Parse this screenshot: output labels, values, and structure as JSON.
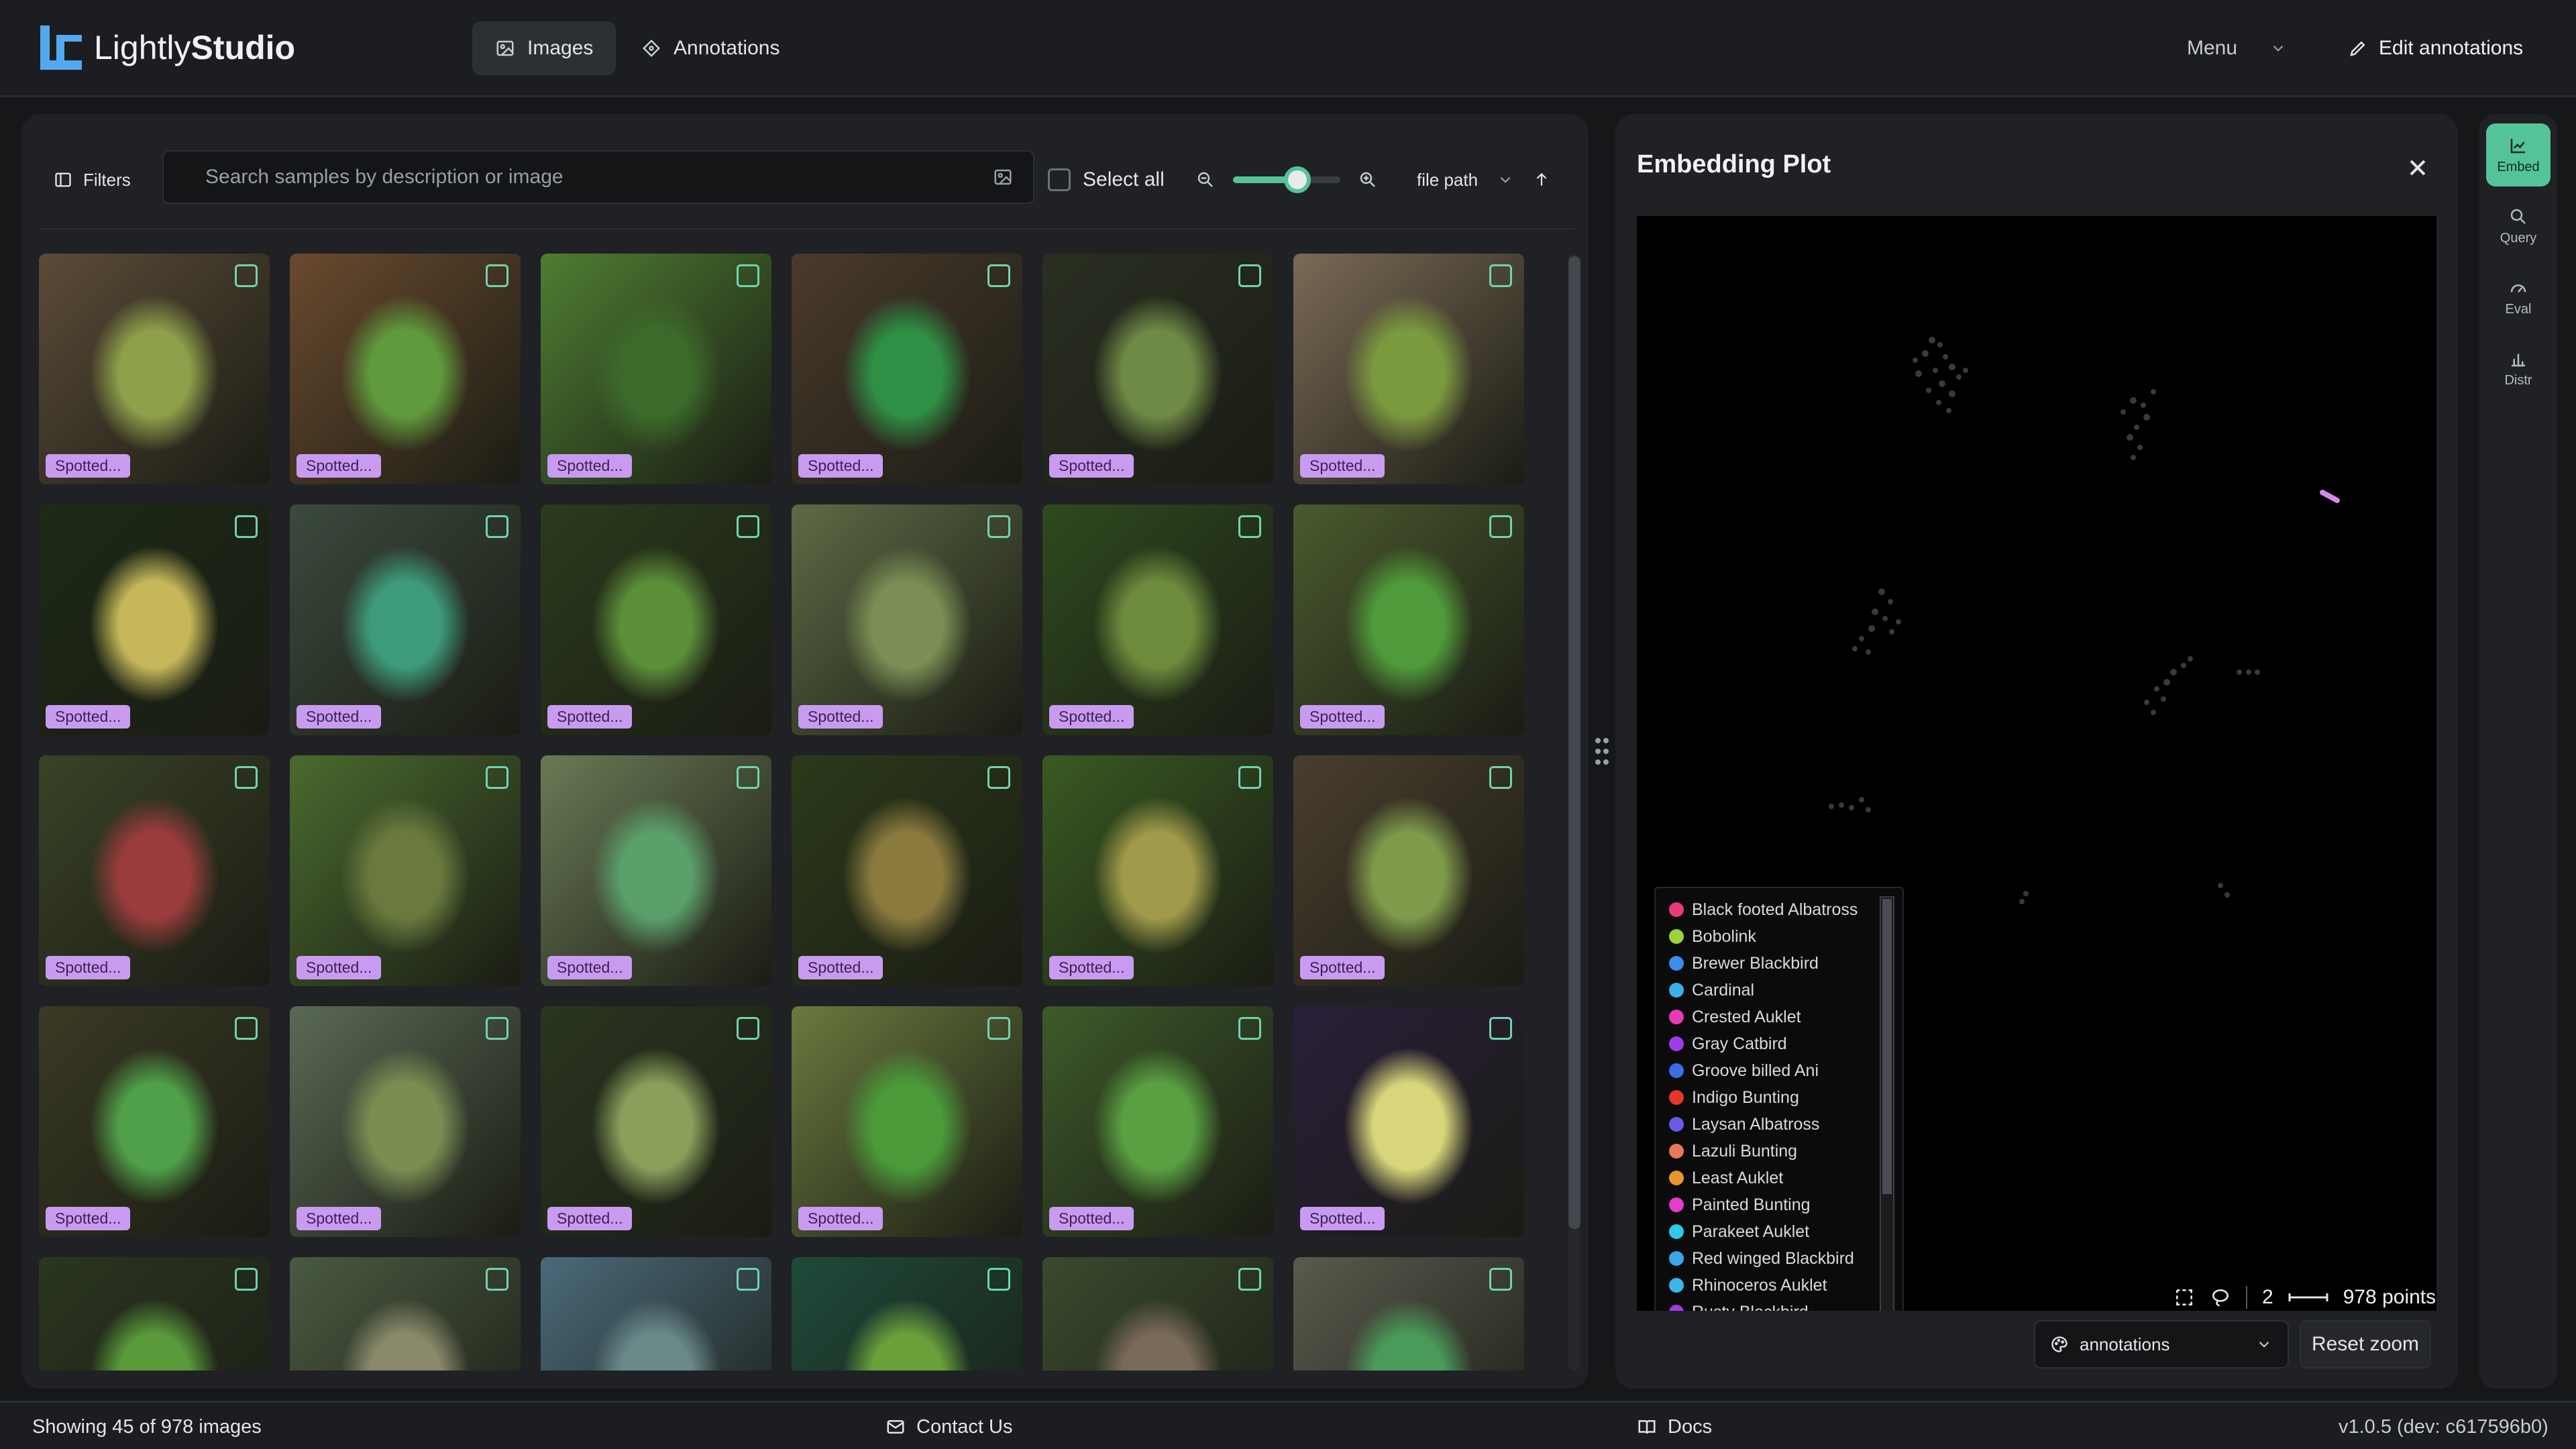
{
  "app": {
    "brand_light": "Lightly",
    "brand_bold": "Studio"
  },
  "nav": {
    "images_label": "Images",
    "annotations_label": "Annotations",
    "menu_label": "Menu",
    "edit_label": "Edit annotations"
  },
  "toolbar": {
    "filters_label": "Filters",
    "search_placeholder": "Search samples by description or image",
    "select_all_label": "Select all",
    "zoom_level": 0.6,
    "sort_field": "file path",
    "sort_direction": "ascending"
  },
  "grid": {
    "rows": [
      [
        {
          "label": "Spotted...",
          "bg": "#5b4b38",
          "fg": "#8ea04a"
        },
        {
          "label": "Spotted...",
          "bg": "#6a4a2e",
          "fg": "#5f9a3c"
        },
        {
          "label": "Spotted...",
          "bg": "#4e7d32",
          "fg": "#3c6a2a"
        },
        {
          "label": "Spotted...",
          "bg": "#4a3a2c",
          "fg": "#2e8f45"
        },
        {
          "label": "Spotted...",
          "bg": "#2a2f22",
          "fg": "#6f8a45"
        },
        {
          "label": "Spotted...",
          "bg": "#7a6a55",
          "fg": "#7b9a3e"
        }
      ],
      [
        {
          "label": "Spotted...",
          "bg": "#1d2a16",
          "fg": "#c6b85a"
        },
        {
          "label": "Spotted...",
          "bg": "#3c4a3e",
          "fg": "#3d9a7a"
        },
        {
          "label": "Spotted...",
          "bg": "#2b3b1c",
          "fg": "#5d8e3a"
        },
        {
          "label": "Spotted...",
          "bg": "#5e6a45",
          "fg": "#7a8e55"
        },
        {
          "label": "Spotted...",
          "bg": "#2f4a1e",
          "fg": "#6e8a3c"
        },
        {
          "label": "Spotted...",
          "bg": "#4a5a2e",
          "fg": "#4f9a3a"
        }
      ],
      [
        {
          "label": "Spotted...",
          "bg": "#3a4226",
          "fg": "#9a3c3c"
        },
        {
          "label": "Spotted...",
          "bg": "#4a6a2e",
          "fg": "#6a7a3e"
        },
        {
          "label": "Spotted...",
          "bg": "#6a7a55",
          "fg": "#5aa06a"
        },
        {
          "label": "Spotted...",
          "bg": "#2c3a1a",
          "fg": "#8a7a3e"
        },
        {
          "label": "Spotted...",
          "bg": "#3a5a22",
          "fg": "#a09a4a"
        },
        {
          "label": "Spotted...",
          "bg": "#4a3e2e",
          "fg": "#7e9a4a"
        }
      ],
      [
        {
          "label": "Spotted...",
          "bg": "#3a3a24",
          "fg": "#4fa048"
        },
        {
          "label": "Spotted...",
          "bg": "#5a6a55",
          "fg": "#7a8e52"
        },
        {
          "label": "Spotted...",
          "bg": "#2a3620",
          "fg": "#8aa05a"
        },
        {
          "label": "Spotted...",
          "bg": "#6a7a3e",
          "fg": "#4a9a3a"
        },
        {
          "label": "Spotted...",
          "bg": "#3e5a2a",
          "fg": "#5aa042"
        },
        {
          "label": "Spotted...",
          "bg": "#2a1e3a",
          "fg": "#d8d67a"
        }
      ],
      [
        {
          "label": "",
          "bg": "#2a3620",
          "fg": "#5a9a3a"
        },
        {
          "label": "",
          "bg": "#4a5a42",
          "fg": "#8a8a6a"
        },
        {
          "label": "",
          "bg": "#4a6a7a",
          "fg": "#6a8a8a"
        },
        {
          "label": "",
          "bg": "#1e4a3a",
          "fg": "#6aa03a"
        },
        {
          "label": "",
          "bg": "#3a4a2e",
          "fg": "#7a6a5a"
        },
        {
          "label": "",
          "bg": "#5a5a4e",
          "fg": "#4a9a5a"
        }
      ]
    ]
  },
  "embedding": {
    "title": "Embedding Plot",
    "legend": [
      {
        "name": "Black footed Albatross",
        "color": "#e83a7a"
      },
      {
        "name": "Bobolink",
        "color": "#9cd33a"
      },
      {
        "name": "Brewer Blackbird",
        "color": "#3a8ee8"
      },
      {
        "name": "Cardinal",
        "color": "#3ab0e8"
      },
      {
        "name": "Crested Auklet",
        "color": "#e83ab8"
      },
      {
        "name": "Gray Catbird",
        "color": "#a23ae8"
      },
      {
        "name": "Groove billed Ani",
        "color": "#3a6ee8"
      },
      {
        "name": "Indigo Bunting",
        "color": "#e8352e"
      },
      {
        "name": "Laysan Albatross",
        "color": "#6a5ae8"
      },
      {
        "name": "Lazuli Bunting",
        "color": "#e8785a"
      },
      {
        "name": "Least Auklet",
        "color": "#e8952e"
      },
      {
        "name": "Painted Bunting",
        "color": "#e83acb"
      },
      {
        "name": "Parakeet Auklet",
        "color": "#2ecbe8"
      },
      {
        "name": "Red winged Blackbird",
        "color": "#3aa8e8"
      },
      {
        "name": "Rhinoceros Auklet",
        "color": "#3ab8e8"
      },
      {
        "name": "Rusty Blackbird",
        "color": "#a33ae8"
      }
    ],
    "scale_value": "2",
    "points_label": "978 points",
    "color_by": "annotations",
    "reset_zoom_label": "Reset zoom"
  },
  "rail": {
    "embed": "Embed",
    "query": "Query",
    "eval": "Eval",
    "distr": "Distr"
  },
  "footer": {
    "showing": "Showing 45 of 978 images",
    "contact": "Contact Us",
    "docs": "Docs",
    "version": "v1.0.5 (dev: c617596b0)"
  }
}
